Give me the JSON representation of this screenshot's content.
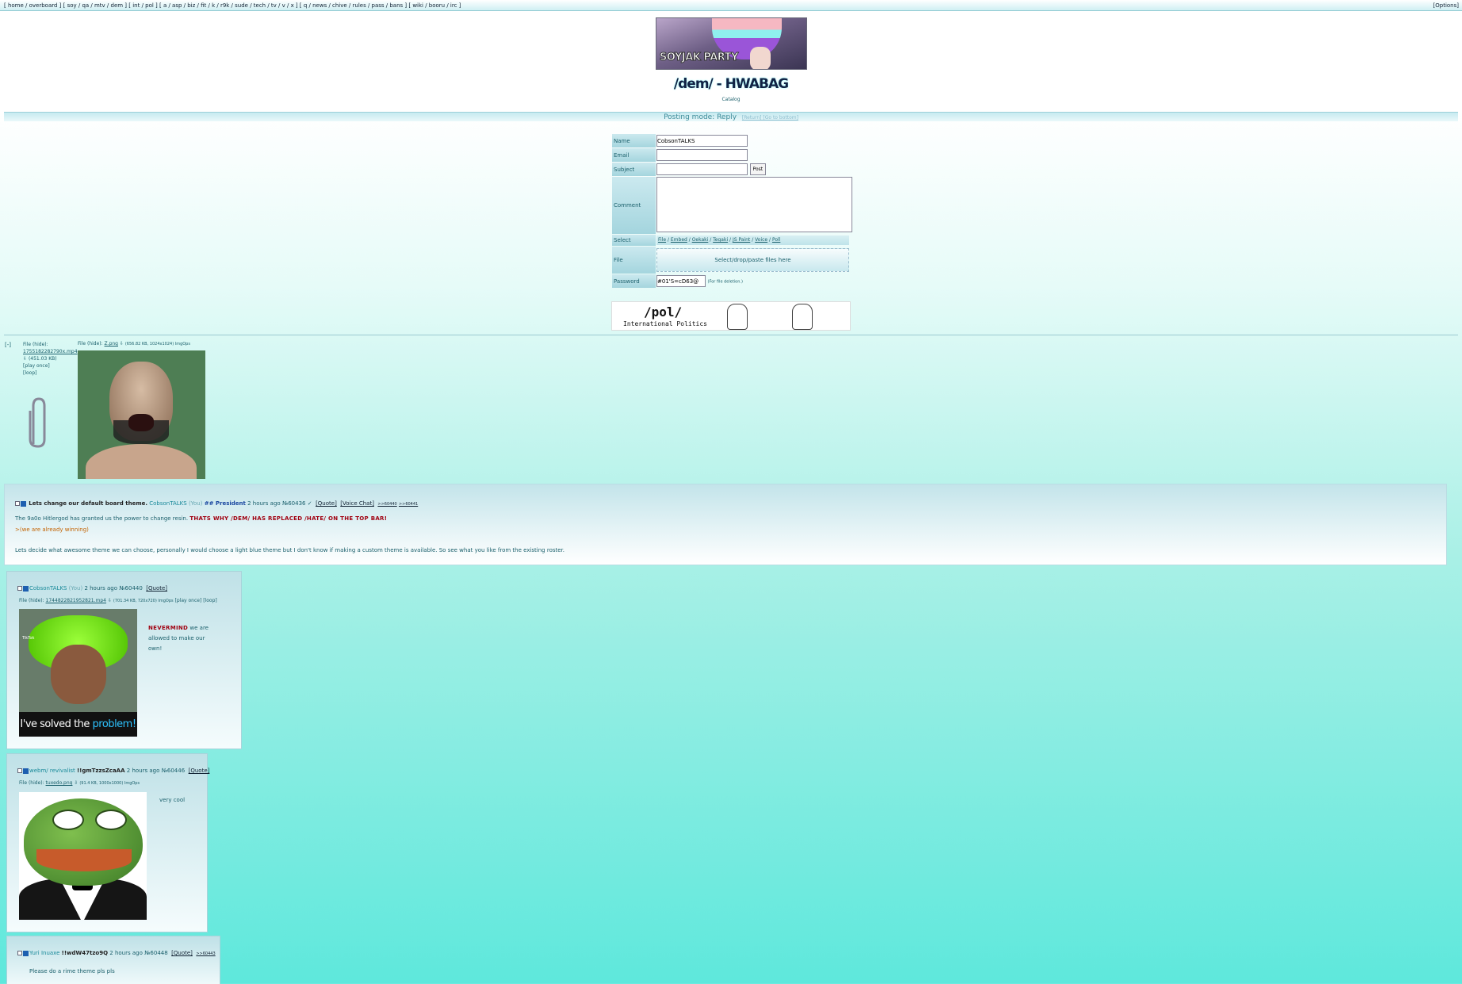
{
  "topbar": {
    "links": "[ home / overboard ] [ soy / qa / mtv / dem ] [ int / pol ] [ a / asp / biz / fit / k / r9k / sude / tech / tv / v / x ] [ q / news / chive / rules / pass / bans ] [ wiki / booru / irc ]",
    "options": "[Options]"
  },
  "banner": {
    "text": "SOYJAK PARTY"
  },
  "board": {
    "title": "/dem/ - HWABAG",
    "catalog": "Catalog"
  },
  "mode": {
    "label": "Posting mode: Reply",
    "return": "[Return] [Go to bottom]"
  },
  "form": {
    "name_label": "Name",
    "name_value": "CobsonTALKS",
    "email_label": "Email",
    "subject_label": "Subject",
    "post_button": "Post",
    "comment_label": "Comment",
    "select_label": "Select",
    "select_options": [
      "File",
      "Embed",
      "Oekaki",
      "Tegaki",
      "JS Paint",
      "Voice",
      "Poll"
    ],
    "file_label": "File",
    "dropzone": "Select/drop/paste files here",
    "password_label": "Password",
    "password_value": "#01'S=cD63@",
    "password_hint": "(For file deletion.)"
  },
  "ad": {
    "title": "/pol/",
    "subtitle": "International Politics"
  },
  "op": {
    "hide": "[-]",
    "file1": {
      "label": "File (hide):",
      "name": "1755182282790x.mp4",
      "size": "(451.03 KB)",
      "play_once": "[play once]",
      "loop": "[loop]"
    },
    "file2": {
      "label": "File (hide):",
      "name": "Z.png",
      "meta": "(656.82 KB, 1024x1024) ImgOps"
    },
    "subject": "Lets change our default board theme.",
    "name": "CobsonTALKS",
    "you": "(You)",
    "capcode": "## President",
    "time": "2 hours ago",
    "no": "№60436",
    "quote": "[Quote]",
    "voice": "[Voice Chat]",
    "r1": ">>60440",
    "r2": ">>60441",
    "line1": "The 9a0o Hitlergod has granted us the power to change resin.",
    "line1_red": "THATS WHY /DEM/ HAS REPLACED /HATE/ ON THE TOP BAR!",
    "line2": ">(we are already winning)",
    "line3": "Lets decide what awesome theme we can choose, personally I would choose a light blue theme but I don't know if making a custom theme is available. So see what you like from the existing roster."
  },
  "replies": [
    {
      "name": "CobsonTALKS",
      "you": "(You)",
      "time": "2 hours ago",
      "no": "№60440",
      "quote": "[Quote]",
      "file_label": "File (hide):",
      "file": "1744822821952821.mp4",
      "meta": "(701.34 KB, 720x720) ImgOps",
      "play": "[play once] [loop]",
      "red": "NEVERMIND",
      "msg": "we are allowed to make our own!",
      "caption": "I've solved the",
      "caption_blue": "problem!",
      "tiktok": "TikTok"
    },
    {
      "name": "webm/ revivalist",
      "trip": "!!gmTzzsZcaAA",
      "time": "2 hours ago",
      "no": "№60446",
      "quote": "[Quote]",
      "file_label": "File (hide):",
      "file": "tuxedo.png",
      "meta": "(91.4 KB, 1000x1000) ImgOps",
      "msg": "very cool"
    },
    {
      "name": "Yuri Inuaxe",
      "trip": "!!wdW47tzo9Q",
      "time": "2 hours ago",
      "no": "№60448",
      "quote": "[Quote]",
      "r1": ">>60443",
      "msg": "Please do a rime theme pls pls"
    }
  ]
}
